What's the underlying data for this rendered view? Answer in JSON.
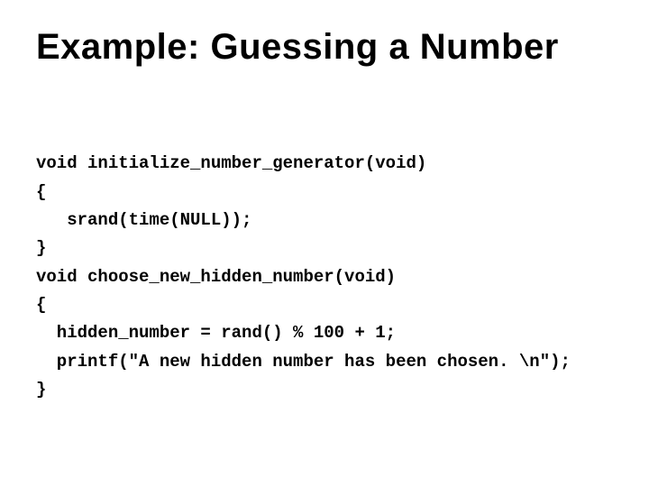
{
  "title": "Example: Guessing a Number",
  "code": {
    "l1": "void initialize_number_generator(void)",
    "l2": "{",
    "l3": "   srand(time(NULL));",
    "l4": "}",
    "l5": "void choose_new_hidden_number(void)",
    "l6": "{",
    "l7": "  hidden_number = rand() % 100 + 1;",
    "l8": "  printf(\"A new hidden number has been chosen. \\n\");",
    "l9": "}"
  }
}
